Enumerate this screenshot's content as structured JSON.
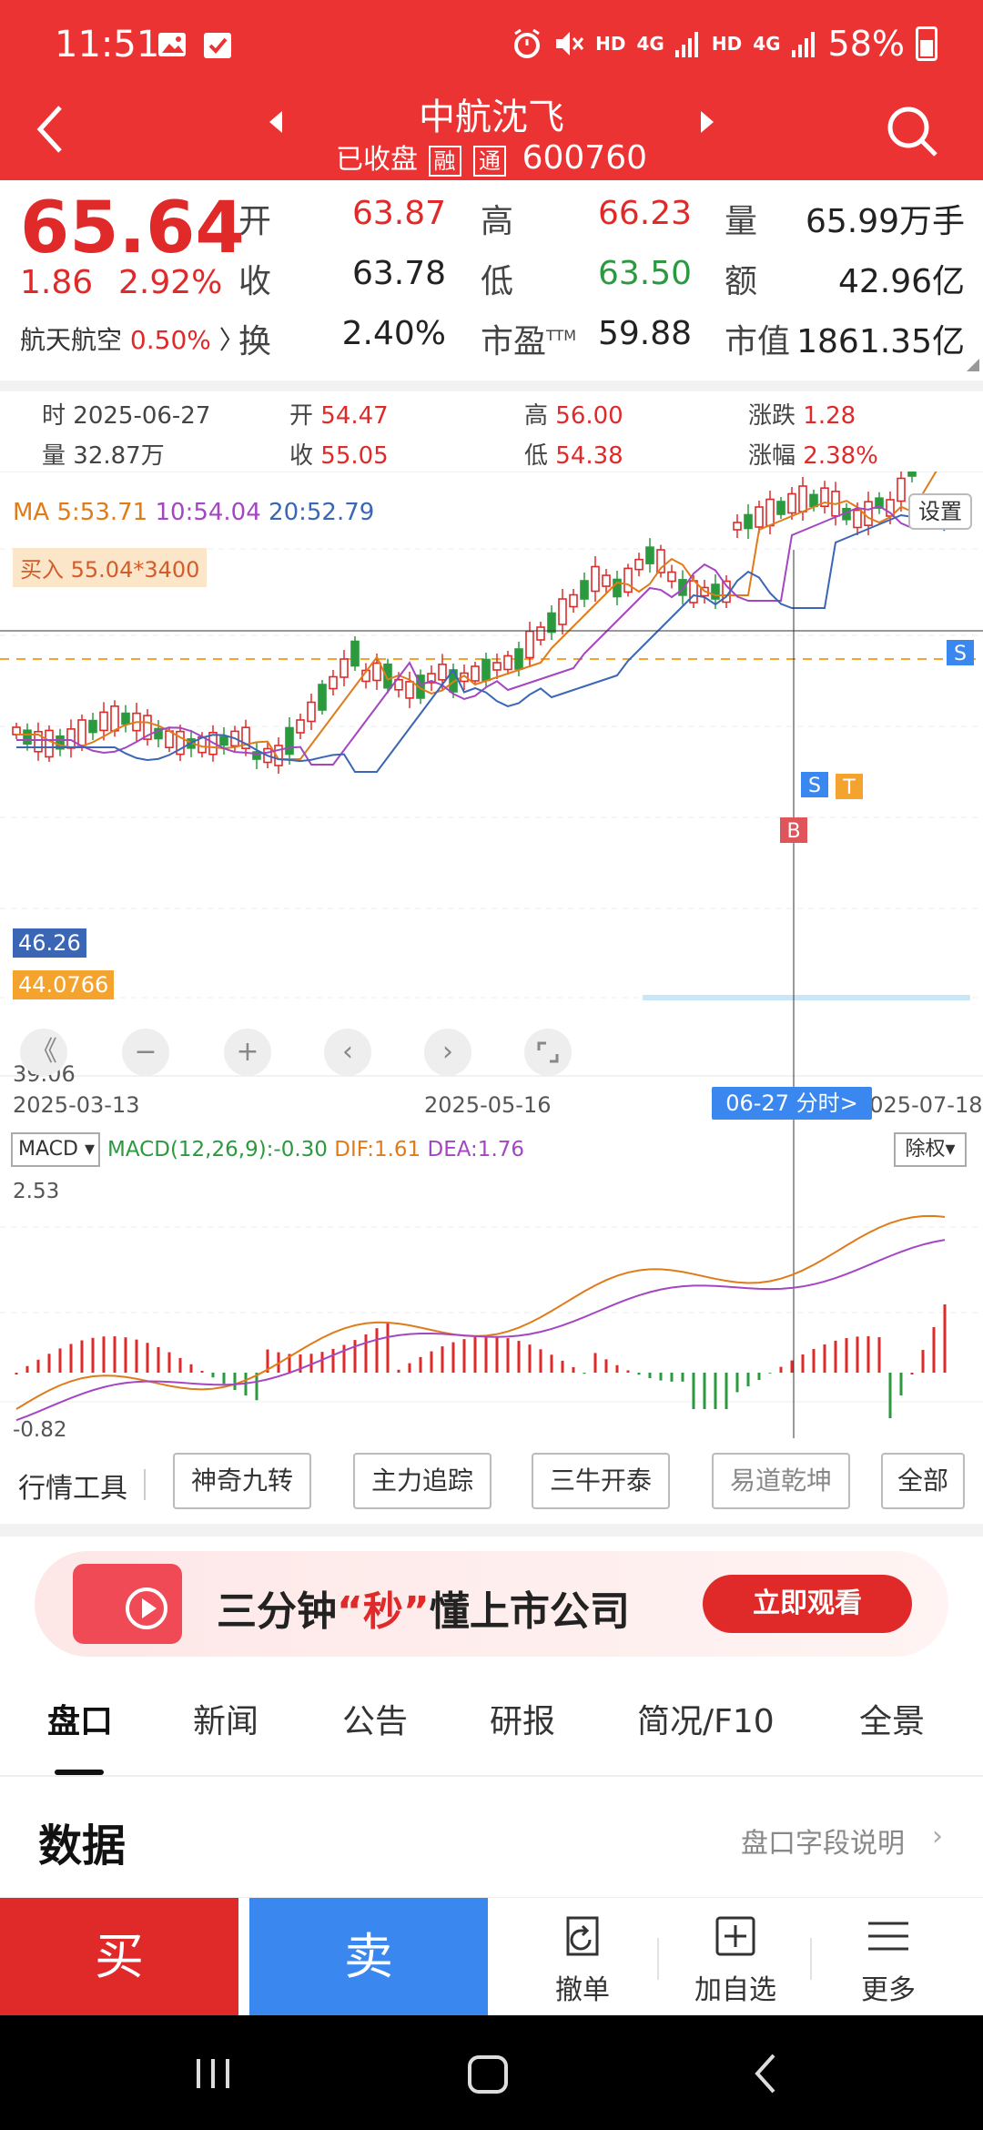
{
  "status_bar": {
    "time": "11:51",
    "signal_1": "HD",
    "signal_2": "4G",
    "signal_3": "HD",
    "signal_4": "4G",
    "battery": "58%"
  },
  "nav": {
    "title": "中航沈飞",
    "status": "已收盘",
    "tag_margin": "融",
    "tag_connect": "通",
    "code": "600760"
  },
  "quote": {
    "price": "65.64",
    "change": "1.86",
    "change_pct": "2.92%",
    "sector_name": "航天航空",
    "sector_pct": "0.50%",
    "sector_chevron": "〉",
    "open_label": "开",
    "open": "63.87",
    "high_label": "高",
    "high": "66.23",
    "volume_label": "量",
    "volume": "65.99万手",
    "close_label": "收",
    "close": "63.78",
    "low_label": "低",
    "low": "63.50",
    "amount_label": "额",
    "amount": "42.96亿",
    "turnover_label": "换",
    "turnover": "2.40%",
    "pe_label": "市盈",
    "pe_sup": "TTM",
    "pe": "59.88",
    "mcap_label": "市值",
    "mcap": "1861.35亿"
  },
  "day_info": {
    "date_label": "时",
    "date": "2025-06-27",
    "open_label": "开",
    "open": "54.47",
    "high_label": "高",
    "high": "56.00",
    "change_label": "涨跌",
    "change": "1.28",
    "vol_label": "量",
    "vol": "32.87万",
    "close_label": "收",
    "close": "55.05",
    "low_label": "低",
    "low": "54.38",
    "pct_label": "涨幅",
    "pct": "2.38%"
  },
  "chart": {
    "ma5": "MA 5:53.71",
    "ma10": "10:54.04",
    "ma20": "20:52.79",
    "settings": "设置",
    "buy_marker": "买入 55.04*3400",
    "crosshair_price": "46.26",
    "cost_price": "44.0766",
    "low_axis": "39.06",
    "date_start": "2025-03-13",
    "date_mid": "2025-05-16",
    "date_end": "2025-07-18",
    "date_pill": "06-27 分时>",
    "marker_s": "S",
    "marker_t": "T",
    "marker_b": "B",
    "ctrl_back": "《",
    "ctrl_minus": "−",
    "ctrl_plus": "+",
    "ctrl_left": "‹",
    "ctrl_right": "›",
    "colors": {
      "up": "#e02a2a",
      "down": "#2b9a3e",
      "ma5": "#e07b1a",
      "ma10": "#a446c2",
      "ma20": "#3a66b5"
    }
  },
  "macd": {
    "selector": "MACD",
    "params": "MACD(12,26,9):-0.30",
    "dif": "DIF:1.61",
    "dea": "DEA:1.76",
    "rights": "除权",
    "top": "2.53",
    "bottom": "-0.82"
  },
  "tools": {
    "label": "行情工具",
    "items": [
      "神奇九转",
      "主力追踪",
      "三牛开泰",
      "易道乾坤"
    ],
    "all": "全部"
  },
  "banner": {
    "text_a": "三分钟",
    "text_em": "“秒”",
    "text_b": "懂上市公司",
    "cta": "立即观看"
  },
  "tabs": [
    "盘口",
    "新闻",
    "公告",
    "研报",
    "简况/F10",
    "全景"
  ],
  "section": {
    "title": "数据",
    "link": "盘口字段说明",
    "chevron": "›"
  },
  "trade": {
    "buy": "买",
    "sell": "卖",
    "cancel": "撤单",
    "add_watch": "加自选",
    "more": "更多"
  }
}
